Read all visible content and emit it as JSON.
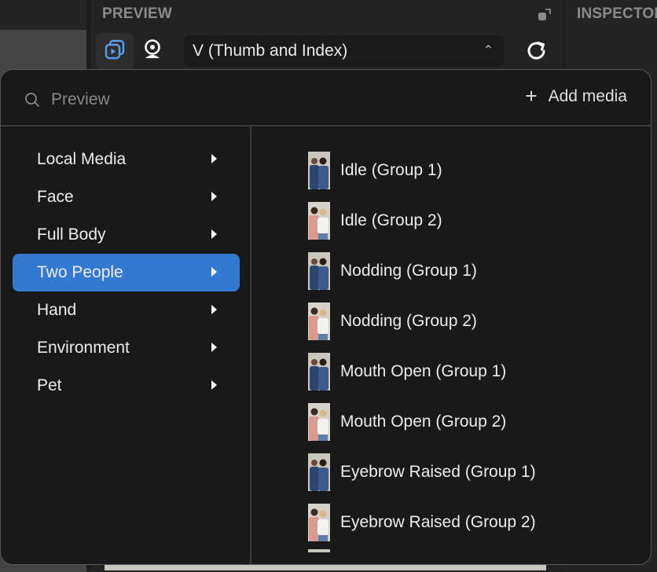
{
  "app": {
    "preview_title": "PREVIEW",
    "inspector_title": "INSPECTOR",
    "toolbar": {
      "media_button_icon": "media-stack-icon",
      "webcam_button_icon": "webcam-icon",
      "refresh_icon": "refresh-icon",
      "popout_icon": "popout-icon"
    },
    "dropdown": {
      "selected": "V (Thumb and Index)",
      "caret_icon": "chevron-up-icon"
    }
  },
  "colors": {
    "accent": "#3479cf",
    "icon_active": "#5b9bef",
    "popup_bg": "#191919"
  },
  "popup": {
    "search": {
      "placeholder": "Preview",
      "value": "",
      "icon": "search-icon"
    },
    "add_media": {
      "icon": "plus-icon",
      "label": "Add media"
    },
    "categories": [
      {
        "label": "Local Media",
        "selected": false
      },
      {
        "label": "Face",
        "selected": false
      },
      {
        "label": "Full Body",
        "selected": false
      },
      {
        "label": "Two People",
        "selected": true
      },
      {
        "label": "Hand",
        "selected": false
      },
      {
        "label": "Environment",
        "selected": false
      },
      {
        "label": "Pet",
        "selected": false
      }
    ],
    "media_items": [
      {
        "label": "Idle (Group 1)",
        "group": 1
      },
      {
        "label": "Idle (Group 2)",
        "group": 2
      },
      {
        "label": "Nodding (Group 1)",
        "group": 1
      },
      {
        "label": "Nodding (Group 2)",
        "group": 2
      },
      {
        "label": "Mouth Open (Group 1)",
        "group": 1
      },
      {
        "label": "Mouth Open (Group 2)",
        "group": 2
      },
      {
        "label": "Eyebrow Raised (Group 1)",
        "group": 1
      },
      {
        "label": "Eyebrow Raised (Group 2)",
        "group": 2
      }
    ]
  }
}
